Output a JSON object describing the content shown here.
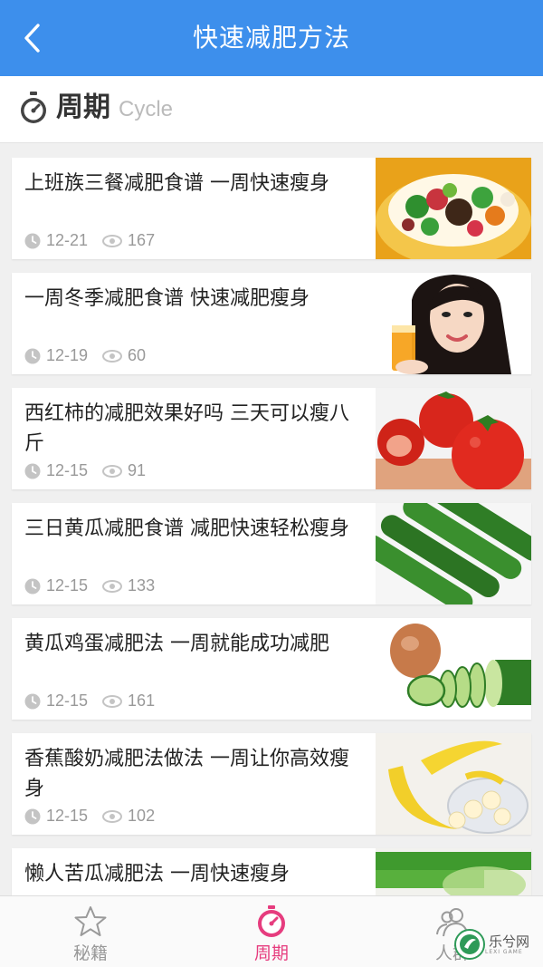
{
  "header": {
    "title": "快速减肥方法",
    "back_icon": "chevron-left-icon"
  },
  "section": {
    "title": "周期",
    "subtitle": "Cycle",
    "icon": "stopwatch-icon"
  },
  "articles": [
    {
      "title": "上班族三餐减肥食谱 一周快速瘦身",
      "date": "12-21",
      "views": "167",
      "thumb": "salad-image"
    },
    {
      "title": "一周冬季减肥食谱 快速减肥瘦身",
      "date": "12-19",
      "views": "60",
      "thumb": "girl-orange-juice-image"
    },
    {
      "title": "西红柿的减肥效果好吗 三天可以瘦八斤",
      "date": "12-15",
      "views": "91",
      "thumb": "tomatoes-image"
    },
    {
      "title": "三日黄瓜减肥食谱 减肥快速轻松瘦身",
      "date": "12-15",
      "views": "133",
      "thumb": "cucumbers-image"
    },
    {
      "title": "黄瓜鸡蛋减肥法 一周就能成功减肥",
      "date": "12-15",
      "views": "161",
      "thumb": "egg-cucumber-image"
    },
    {
      "title": "香蕉酸奶减肥法做法 一周让你高效瘦身",
      "date": "12-15",
      "views": "102",
      "thumb": "banana-yogurt-image"
    },
    {
      "title": "懒人苦瓜减肥法 一周快速瘦身",
      "date": "",
      "views": "",
      "thumb": "bitter-melon-image"
    }
  ],
  "tabs": [
    {
      "label": "秘籍",
      "icon": "star-icon",
      "active": false
    },
    {
      "label": "周期",
      "icon": "stopwatch-icon",
      "active": true
    },
    {
      "label": "人群",
      "icon": "people-icon",
      "active": false
    }
  ],
  "watermark": {
    "text": "乐兮网",
    "sub": "LEXI GAME"
  },
  "colors": {
    "primary": "#3d8fec",
    "active_tab": "#e63c7e",
    "meta": "#999999"
  }
}
